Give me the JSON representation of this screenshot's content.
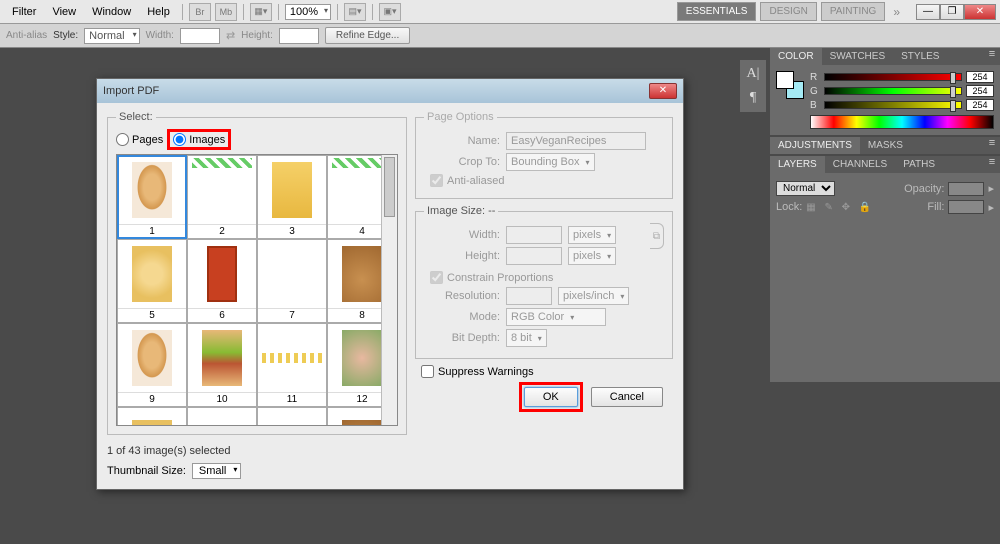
{
  "menu": {
    "filter": "Filter",
    "view": "View",
    "window": "Window",
    "help": "Help",
    "zoom": "100%"
  },
  "workspace": {
    "essentials": "ESSENTIALS",
    "design": "DESIGN",
    "painting": "PAINTING"
  },
  "options": {
    "antialias": "Anti-alias",
    "style_label": "Style:",
    "style_value": "Normal",
    "width_label": "Width:",
    "height_label": "Height:",
    "refine": "Refine Edge..."
  },
  "panels": {
    "color": {
      "tab_color": "COLOR",
      "tab_swatches": "SWATCHES",
      "tab_styles": "STYLES",
      "r": "R",
      "g": "G",
      "b": "B",
      "val": "254"
    },
    "adjustments": {
      "tab_adj": "ADJUSTMENTS",
      "tab_masks": "MASKS"
    },
    "layers": {
      "tab_layers": "LAYERS",
      "tab_channels": "CHANNELS",
      "tab_paths": "PATHS",
      "blend": "Normal",
      "opacity_label": "Opacity:",
      "lock_label": "Lock:",
      "fill_label": "Fill:"
    }
  },
  "dialog": {
    "title": "Import PDF",
    "select_legend": "Select:",
    "pages": "Pages",
    "images": "Images",
    "status": "1 of 43 image(s) selected",
    "thumbsize_label": "Thumbnail Size:",
    "thumbsize_value": "Small",
    "thumbs": [
      "1",
      "2",
      "3",
      "4",
      "5",
      "6",
      "7",
      "8",
      "9",
      "10",
      "11",
      "12"
    ],
    "pageopts": {
      "legend": "Page Options",
      "name_label": "Name:",
      "name_value": "EasyVeganRecipes",
      "crop_label": "Crop To:",
      "crop_value": "Bounding Box",
      "antialiased": "Anti-aliased"
    },
    "imagesize": {
      "legend": "Image Size: --",
      "width": "Width:",
      "height": "Height:",
      "pixels": "pixels",
      "constrain": "Constrain Proportions",
      "resolution": "Resolution:",
      "ppi": "pixels/inch",
      "mode": "Mode:",
      "mode_value": "RGB Color",
      "bitdepth": "Bit Depth:",
      "bitdepth_value": "8 bit"
    },
    "suppress": "Suppress Warnings",
    "ok": "OK",
    "cancel": "Cancel"
  }
}
